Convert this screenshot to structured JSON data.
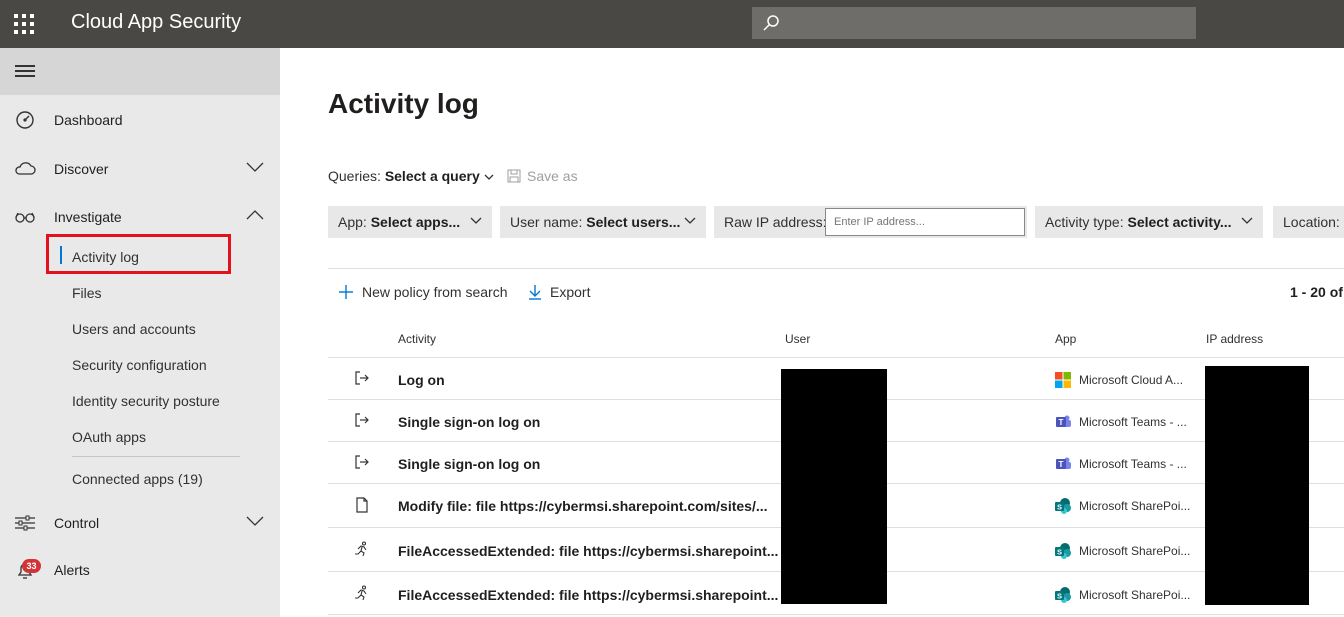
{
  "topbar": {
    "title": "Cloud App Security"
  },
  "sidebar": {
    "items": [
      {
        "label": "Dashboard"
      },
      {
        "label": "Discover"
      },
      {
        "label": "Investigate"
      },
      {
        "label": "Control"
      },
      {
        "label": "Alerts"
      }
    ],
    "investigate_sub": [
      {
        "label": "Activity log"
      },
      {
        "label": "Files"
      },
      {
        "label": "Users and accounts"
      },
      {
        "label": "Security configuration"
      },
      {
        "label": "Identity security posture"
      },
      {
        "label": "OAuth apps"
      },
      {
        "label": "Connected apps (19)"
      }
    ],
    "alerts_badge": "33"
  },
  "main": {
    "title": "Activity log",
    "queries_label": "Queries:",
    "queries_value": "Select a query",
    "save_as": "Save as",
    "filters": {
      "app_label": "App:",
      "app_value": "Select apps...",
      "user_label": "User name:",
      "user_value": "Select users...",
      "ip_label": "Raw IP address:",
      "ip_placeholder": "Enter IP address...",
      "activity_label": "Activity type:",
      "activity_value": "Select activity...",
      "location_label": "Location:"
    },
    "actions": {
      "new_policy": "New policy from search",
      "export": "Export"
    },
    "pager": "1 - 20 of",
    "columns": {
      "activity": "Activity",
      "user": "User",
      "app": "App",
      "ip": "IP address"
    },
    "rows": [
      {
        "activity": "Log on",
        "app": "Microsoft Cloud A...",
        "icon": "sign-in-icon",
        "app_icon": "microsoft-logo-icon"
      },
      {
        "activity": "Single sign-on log on",
        "app": "Microsoft Teams - ...",
        "icon": "sign-in-icon",
        "app_icon": "teams-icon"
      },
      {
        "activity": "Single sign-on log on",
        "app": "Microsoft Teams - ...",
        "icon": "sign-in-icon",
        "app_icon": "teams-icon"
      },
      {
        "activity": "Modify file: file https://cybermsi.sharepoint.com/sites/...",
        "app": "Microsoft SharePoi...",
        "icon": "file-icon",
        "app_icon": "sharepoint-icon"
      },
      {
        "activity": "FileAccessedExtended: file https://cybermsi.sharepoint...",
        "app": "Microsoft SharePoi...",
        "icon": "activity-run-icon",
        "app_icon": "sharepoint-icon"
      },
      {
        "activity": "FileAccessedExtended: file https://cybermsi.sharepoint...",
        "app": "Microsoft SharePoi...",
        "icon": "activity-run-icon",
        "app_icon": "sharepoint-icon"
      }
    ]
  },
  "colors": {
    "topbar": "#494845",
    "accent": "#0078d4",
    "highlight": "#e3101e",
    "badge": "#d13438"
  }
}
